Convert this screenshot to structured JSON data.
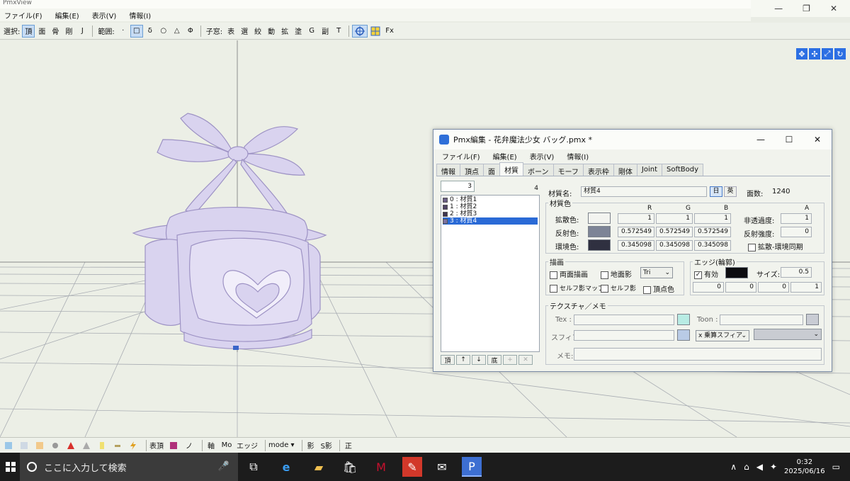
{
  "window": {
    "title": "PmxView",
    "controls": [
      "—",
      "❐",
      "✕"
    ]
  },
  "menubar": [
    "ファイル(F)",
    "編集(E)",
    "表示(V)",
    "情報(I)"
  ],
  "toolbar": {
    "select_label": "選択:",
    "select_items": [
      "頂",
      "面",
      "骨",
      "剛",
      "J"
    ],
    "range_label": "範囲:",
    "range_items": [
      "·",
      "□",
      "δ",
      "○",
      "△",
      "Φ"
    ],
    "subwin_label": "子窓:",
    "subwin_items": [
      "表",
      "選",
      "絞",
      "動",
      "拡",
      "塗",
      "G",
      "副",
      "T"
    ],
    "fx_label": "Fx"
  },
  "nav_icons": [
    "move-xyz-icon",
    "move-icon",
    "pan-icon",
    "rotate-icon"
  ],
  "bottombar": {
    "items": [
      "表頂",
      "ノ",
      "軸",
      "Mo",
      "エッジ",
      "mode",
      "影",
      "S影",
      "正"
    ]
  },
  "taskbar": {
    "search_placeholder": "ここに入力して検索",
    "clock_time": "0:32",
    "clock_date": "2025/06/16"
  },
  "dialog": {
    "title": "Pmx編集 - 花弁魔法少女 バッグ.pmx *",
    "menu": [
      "ファイル(F)",
      "編集(E)",
      "表示(V)",
      "情報(I)"
    ],
    "tabs": [
      "情報",
      "頂点",
      "面",
      "材質",
      "ボーン",
      "モーフ",
      "表示枠",
      "剛体",
      "Joint",
      "SoftBody"
    ],
    "active_tab": "材質",
    "index_value": "3",
    "material_count": "4",
    "materials": [
      {
        "label": "0 : 材質1",
        "color": "#6b5f86"
      },
      {
        "label": "1 : 材質2",
        "color": "#4f4466"
      },
      {
        "label": "2 : 材質3",
        "color": "#3e3550"
      },
      {
        "label": "3 : 材質4",
        "color": "#7d72a0"
      }
    ],
    "list_buttons": [
      "頂",
      "↑",
      "↓",
      "底",
      "+",
      "✕"
    ],
    "name_label": "材質名:",
    "name_value": "材質4",
    "lang_jp": "日",
    "lang_en": "英",
    "face_count_label": "面数:",
    "face_count": "1240",
    "color_group": "材質色",
    "col_r": "R",
    "col_g": "G",
    "col_b": "B",
    "col_a": "A",
    "diffuse_label": "拡散色:",
    "diffuse_rgb": [
      "1",
      "1",
      "1"
    ],
    "specular_label": "反射色:",
    "specular_rgb": [
      "0.572549",
      "0.572549",
      "0.572549"
    ],
    "ambient_label": "環境色:",
    "ambient_rgb": [
      "0.345098",
      "0.345098",
      "0.345098"
    ],
    "opacity_label": "非透過度:",
    "opacity_value": "1",
    "specular_power_label": "反射強度:",
    "specular_power_value": "0",
    "diffuse_ambient_sync_label": "拡散-環境同期",
    "colors": {
      "diffuse": "#f3f4f0",
      "specular": "#7d8496",
      "ambient": "#2f3040",
      "edge": "#0c0c10",
      "tex_swatch": "#b8ece4",
      "sphere_swatch": "#b9cbe6",
      "toon_swatch": "#c9ccd4"
    },
    "draw_group": "描画",
    "double_sided_label": "両面描画",
    "ground_shadow_label": "地面影",
    "draw_mode_value": "Tri",
    "self_shadow_map_label": "セルフ影マップ",
    "self_shadow_label": "セルフ影",
    "vertex_color_label": "頂点色",
    "edge_group": "エッジ(輪郭)",
    "edge_enabled_label": "有効",
    "edge_size_label": "サイズ:",
    "edge_size_value": "0.5",
    "edge_rgba": [
      "0",
      "0",
      "0",
      "1"
    ],
    "texture_group": "テクスチャ／メモ",
    "tex_label": "Tex :",
    "toon_label": "Toon :",
    "sphere_label": "スフィア:",
    "sphere_mode_value": "x 乗算スフィア",
    "memo_label": "メモ:"
  }
}
